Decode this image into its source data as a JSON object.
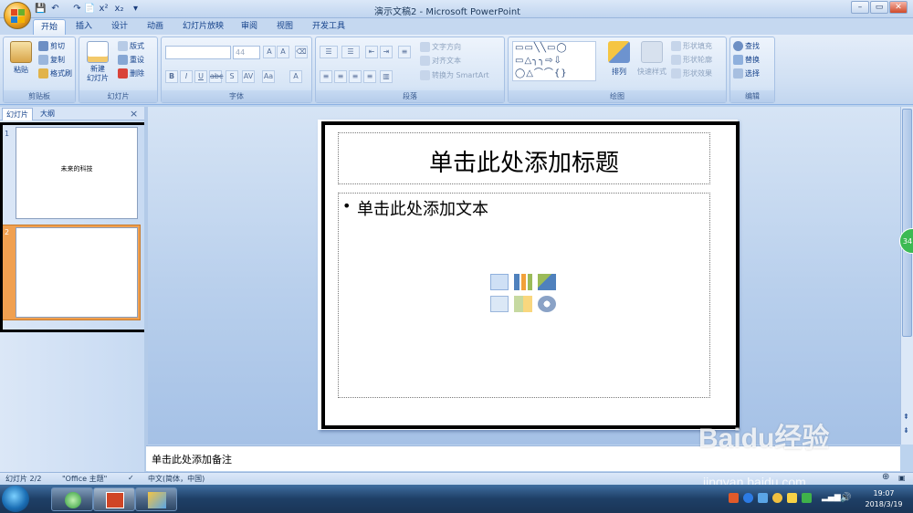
{
  "window": {
    "title": "演示文稿2 - Microsoft PowerPoint",
    "controls": [
      "–",
      "▭",
      "✕"
    ]
  },
  "qat": [
    "💾",
    "↶",
    "↷",
    "📄",
    "x²",
    "x₂",
    "▾"
  ],
  "tabs": [
    {
      "label": "开始",
      "active": true
    },
    {
      "label": "插入"
    },
    {
      "label": "设计"
    },
    {
      "label": "动画"
    },
    {
      "label": "幻灯片放映"
    },
    {
      "label": "审阅"
    },
    {
      "label": "视图"
    },
    {
      "label": "开发工具"
    }
  ],
  "ribbon": {
    "clipboard": {
      "label": "剪贴板",
      "paste": "粘贴",
      "cut": "剪切",
      "copy": "复制",
      "format_painter": "格式刷"
    },
    "slides": {
      "label": "幻灯片",
      "new_slide": "新建\n幻灯片",
      "layout": "版式",
      "reset": "重设",
      "delete": "删除"
    },
    "font": {
      "label": "字体",
      "size": "44"
    },
    "paragraph": {
      "label": "段落",
      "text_direction": "文字方向",
      "align_text": "对齐文本",
      "convert_smartart": "转换为 SmartArt"
    },
    "drawing": {
      "label": "绘图",
      "arrange": "排列",
      "quick_styles": "快速样式",
      "shape_fill": "形状填充",
      "shape_outline": "形状轮廓",
      "shape_effects": "形状效果"
    },
    "editing": {
      "label": "编辑",
      "find": "查找",
      "replace": "替换",
      "select": "选择"
    }
  },
  "left_pane": {
    "tabs": [
      "幻灯片",
      "大纲"
    ],
    "slides": [
      {
        "number": "1",
        "text": "未来的科技"
      },
      {
        "number": "2",
        "text": ""
      }
    ]
  },
  "slide": {
    "title_placeholder": "单击此处添加标题",
    "body_placeholder": "单击此处添加文本",
    "bullet": "•"
  },
  "notes": {
    "placeholder": "单击此处添加备注"
  },
  "statusbar": {
    "slide_count": "幻灯片 2/2",
    "theme": "\"Office 主题\"",
    "language": "中文(简体，中国)"
  },
  "taskbar": {
    "time": "19:07",
    "date": "2018/3/19"
  },
  "side_badge": "34",
  "watermark": {
    "brand": "Baidu经验",
    "url": "jingyan.baidu.com"
  },
  "colors": {
    "accent": "#15428b",
    "selection": "#f0a050",
    "ribbon": "#dbe8f8"
  }
}
